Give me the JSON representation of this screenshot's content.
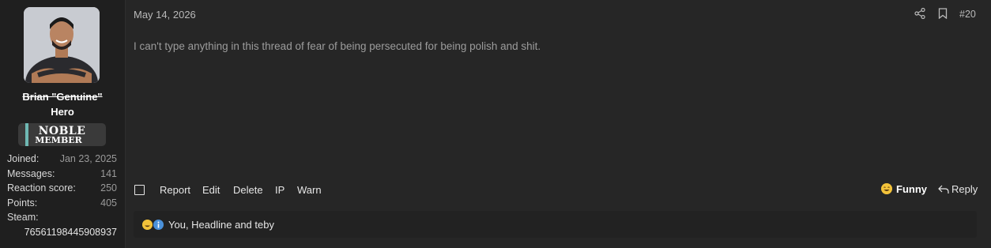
{
  "user": {
    "name_line1": "Brian \"Genuine\"",
    "name_line2": "Hero",
    "rank_line1": "NOBLE",
    "rank_line2": "MEMBER",
    "stats": [
      {
        "label": "Joined:",
        "value": "Jan 23, 2025"
      },
      {
        "label": "Messages:",
        "value": "141"
      },
      {
        "label": "Reaction score:",
        "value": "250"
      },
      {
        "label": "Points:",
        "value": "405"
      }
    ],
    "steam_label": "Steam:",
    "steam_value": "76561198445908937"
  },
  "post": {
    "date": "May 14, 2026",
    "number": "#20",
    "message": "I can't type anything in this thread of fear of being persecuted for being polish and shit."
  },
  "actions": {
    "report": "Report",
    "edit": "Edit",
    "delete": "Delete",
    "ip": "IP",
    "warn": "Warn",
    "funny": "Funny",
    "reply": "Reply"
  },
  "reactions": {
    "text": "You, Headline and teby"
  },
  "colors": {
    "accent_rank": "#6fb8b3",
    "funny_emoji": "#f2c23a",
    "info_badge": "#4a90d9"
  },
  "icons": [
    "share-icon",
    "bookmark-icon",
    "checkbox-icon",
    "funny-emoji-icon",
    "reply-icon",
    "info-reaction-icon"
  ]
}
